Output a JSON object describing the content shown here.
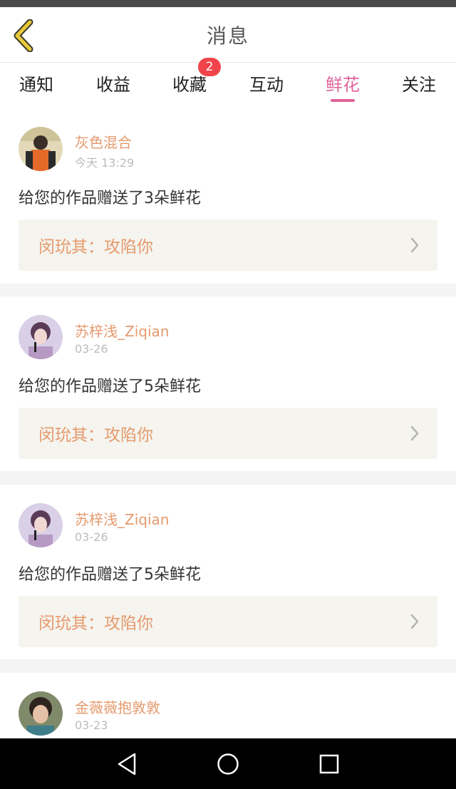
{
  "header": {
    "title": "消息",
    "back_icon": "chevron-left-icon",
    "accent_color": "#e8c93a"
  },
  "tabs": [
    {
      "label": "通知",
      "active": false
    },
    {
      "label": "收益",
      "active": false
    },
    {
      "label": "收藏",
      "active": false,
      "badge": "2"
    },
    {
      "label": "互动",
      "active": false
    },
    {
      "label": "鲜花",
      "active": true
    },
    {
      "label": "关注",
      "active": false
    }
  ],
  "colors": {
    "active_tab": "#e0649b",
    "username": "#e59a6d",
    "badge": "#f0434a",
    "work_box_bg": "#f5f4ee"
  },
  "messages": [
    {
      "username": "灰色混合",
      "time": "今天 13:29",
      "text": "给您的作品赠送了3朵鲜花",
      "work": "闵玧其：攻陷你",
      "avatar_icon": "user-avatar"
    },
    {
      "username": "苏梓浅_Ziqian",
      "time": "03-26",
      "text": "给您的作品赠送了5朵鲜花",
      "work": "闵玧其：攻陷你",
      "avatar_icon": "user-avatar"
    },
    {
      "username": "苏梓浅_Ziqian",
      "time": "03-26",
      "text": "给您的作品赠送了5朵鲜花",
      "work": "闵玧其：攻陷你",
      "avatar_icon": "user-avatar"
    },
    {
      "username": "金薇薇抱敦敦",
      "time": "03-23",
      "text": "",
      "work": "",
      "avatar_icon": "user-avatar"
    }
  ],
  "navbar": {
    "back": "triangle-back-icon",
    "home": "circle-home-icon",
    "recents": "square-recents-icon"
  }
}
